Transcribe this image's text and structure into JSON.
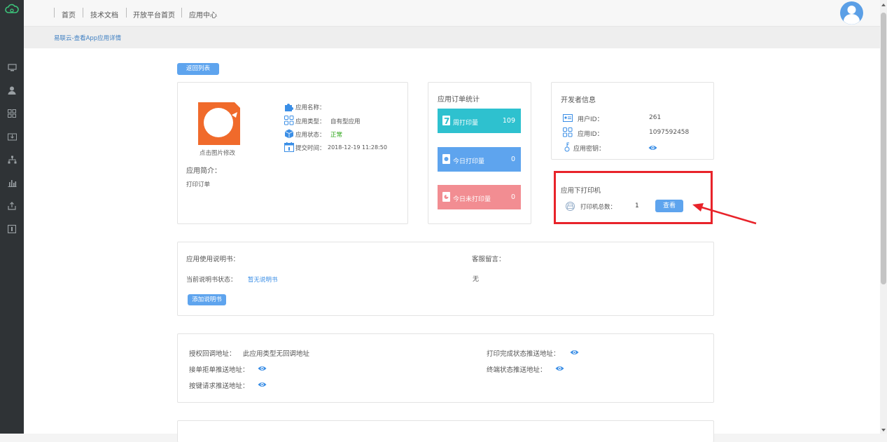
{
  "topnav": {
    "links": [
      "首页",
      "技术文档",
      "开放平台首页",
      "应用中心"
    ]
  },
  "breadcrumb": "易联云-查看App应用详情",
  "back_button": "返回列表",
  "app_info": {
    "change_image_label": "点击图片修改",
    "name_label": "应用名称：",
    "type_label": "应用类型：",
    "type_value": "自有型应用",
    "status_label": "应用状态：",
    "status_value": "正常",
    "submit_label": "提交时间：",
    "submit_value": "2018-12-19 11:28:50",
    "intro_label": "应用简介：",
    "intro_value": "打印订单"
  },
  "order_stats": {
    "title": "应用订单统计",
    "items": [
      {
        "label": "周打印量",
        "value": "109",
        "color": "#2ec1cf"
      },
      {
        "label": "今日打印量",
        "value": "0",
        "color": "#5ea4ee"
      },
      {
        "label": "今日未打印量",
        "value": "0",
        "color": "#f28d92"
      }
    ]
  },
  "developer": {
    "title": "开发者信息",
    "user_id_label": "用户ID：",
    "user_id_value": "261",
    "app_id_label": "应用ID：",
    "app_id_value": "1097592458",
    "secret_label": "应用密钥："
  },
  "printers": {
    "title": "应用下打印机",
    "total_label": "打印机总数：",
    "total_value": "1",
    "view_button": "查看"
  },
  "manual": {
    "title": "应用使用说明书：",
    "status_label": "当前说明书状态：",
    "status_value": "暂无说明书",
    "add_button": "添加说明书",
    "service_label": "客服留言：",
    "service_value": "无"
  },
  "callbacks": {
    "auth_label": "授权回调地址：",
    "auth_value": "此应用类型无回调地址",
    "accept_label": "接单拒单推送地址：",
    "key_label": "按键请求推送地址：",
    "print_done_label": "打印完成状态推送地址：",
    "terminal_label": "终端状态推送地址："
  },
  "colors": {
    "accent": "#5ea4ee",
    "highlight": "#e8232a",
    "status_ok": "#2aa515",
    "app_icon": "#f06a2b"
  }
}
